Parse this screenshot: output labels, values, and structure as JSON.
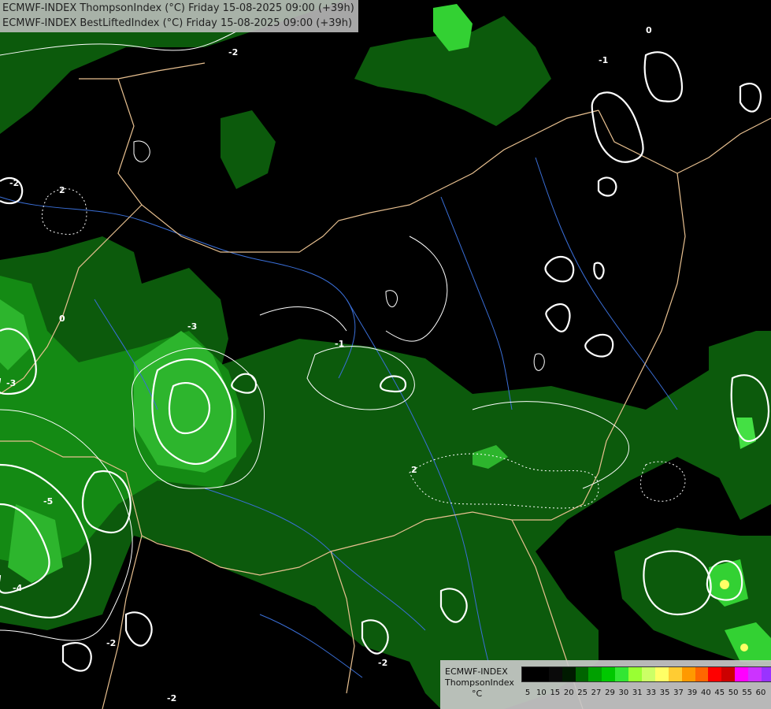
{
  "title": {
    "line1": "ECMWF-INDEX ThompsonIndex (°C) Friday 15-08-2025 09:00 (+39h)",
    "line2": "ECMWF-INDEX BestLiftedIndex (°C) Friday 15-08-2025 09:00 (+39h)"
  },
  "legend": {
    "model": "ECMWF-INDEX",
    "parameter": "ThompsonIndex",
    "unit": "°C",
    "colors": [
      "#000000",
      "#000000",
      "#0a0a0a",
      "#001a00",
      "#006400",
      "#00a000",
      "#00c800",
      "#33e633",
      "#99ff33",
      "#ccff66",
      "#ffff66",
      "#ffcc33",
      "#ff9900",
      "#ff6600",
      "#ff0000",
      "#cc0000",
      "#ff00ff",
      "#cc33ff",
      "#9933ff",
      "#0000ff"
    ],
    "ticks": [
      "5",
      "10",
      "15",
      "20",
      "25",
      "27",
      "29",
      "30",
      "31",
      "33",
      "35",
      "37",
      "39",
      "40",
      "45",
      "50",
      "55",
      "60"
    ]
  },
  "map": {
    "region": "Central Europe / Hungary",
    "colors": {
      "background": "#000000",
      "green_dark": "#0a4d0a",
      "green_mid": "#0f7a0f",
      "green_light": "#2db52d",
      "green_bright": "#44e044",
      "yellow": "#ffff66",
      "border": "#e8c090",
      "river": "#3a6fd8",
      "contour": "#ffffff"
    },
    "contour_labels": [
      "-2",
      "0",
      "-1",
      "2",
      "-2",
      "-3",
      "-5",
      "-4",
      "-3",
      "-2",
      "-1",
      "2",
      "-2",
      "-2",
      "0"
    ]
  }
}
